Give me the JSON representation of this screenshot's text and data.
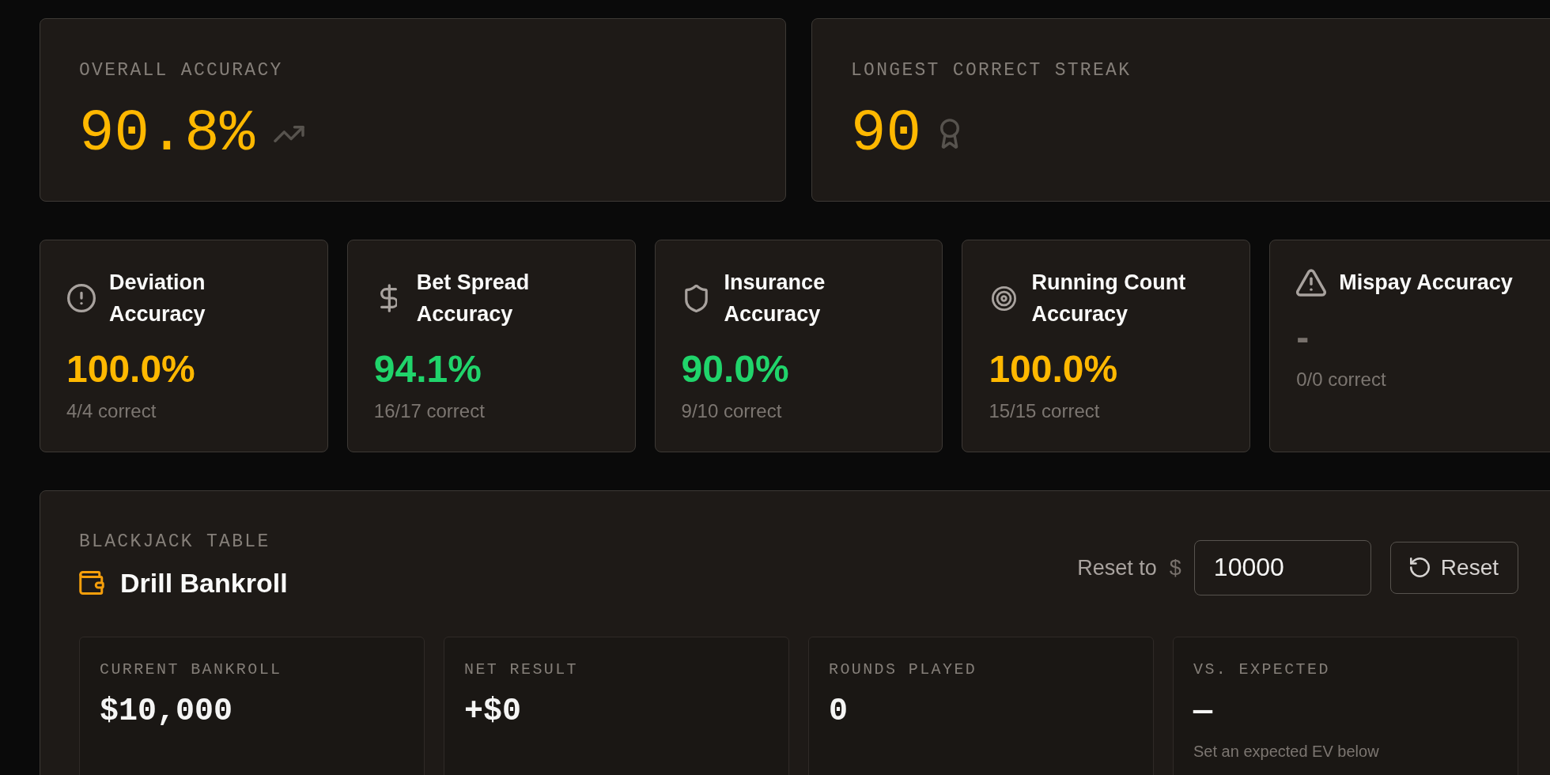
{
  "overview": [
    {
      "kind": "accuracy",
      "label": "OVERALL ACCURACY",
      "value": "90.8%"
    },
    {
      "kind": "streak",
      "label": "LONGEST CORRECT STREAK",
      "value": "90"
    }
  ],
  "metrics": [
    {
      "kind": "deviation",
      "title": "Deviation Accuracy",
      "value": "100.0%",
      "color": "#ffb800",
      "detail": "4/4 correct"
    },
    {
      "kind": "betting",
      "title": "Bet Spread Accuracy",
      "value": "94.1%",
      "color": "#20d46b",
      "detail": "16/17 correct"
    },
    {
      "kind": "insurance",
      "title": "Insurance Accuracy",
      "value": "90.0%",
      "color": "#20d46b",
      "detail": "9/10 correct"
    },
    {
      "kind": "counting",
      "title": "Running Count Accuracy",
      "value": "100.0%",
      "color": "#ffb800",
      "detail": "15/15 correct"
    },
    {
      "kind": "mispay",
      "title": "Mispay Accuracy",
      "value": "-",
      "color": "#78716c",
      "detail": "0/0 correct"
    }
  ],
  "bankroll": {
    "eyebrow": "BLACKJACK TABLE",
    "title": "Drill Bankroll",
    "reset_label": "Reset to",
    "currency": "$",
    "reset_amount": "10000",
    "reset_button": "Reset",
    "stats": [
      {
        "label": "CURRENT BANKROLL",
        "value": "$10,000"
      },
      {
        "label": "NET RESULT",
        "value": "+$0"
      },
      {
        "label": "ROUNDS PLAYED",
        "value": "0"
      },
      {
        "label": "VS. EXPECTED",
        "value": "—",
        "note": "Set an expected EV below"
      }
    ]
  }
}
